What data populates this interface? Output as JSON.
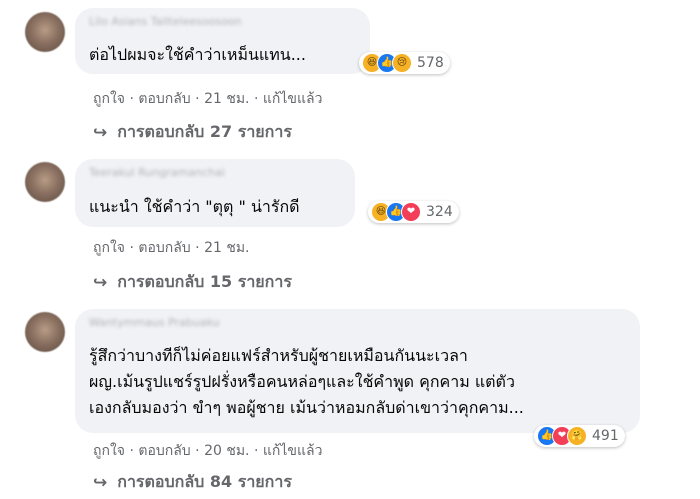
{
  "comments": [
    {
      "author": "Lilo Asians Tallteleesoosoon",
      "text": "ต่อไปผมจะใช้คำว่าเหม็นแทน...",
      "reactions": [
        "haha-icon",
        "like-icon",
        "sad-icon"
      ],
      "reaction_count": "578",
      "like": "ถูกใจ",
      "reply": "ตอบกลับ",
      "time": "21 ชม.",
      "edited": "แก้ไขแล้ว",
      "replies": "การตอบกลับ 27 รายการ"
    },
    {
      "author": "Teerakul Rungramanchai",
      "text": "แนะนำ ใช้คำว่า \"ตุตุ \" น่ารักดี",
      "reactions": [
        "haha-icon",
        "like-icon",
        "love-icon"
      ],
      "reaction_count": "324",
      "like": "ถูกใจ",
      "reply": "ตอบกลับ",
      "time": "21 ชม.",
      "edited": "",
      "replies": "การตอบกลับ 15 รายการ"
    },
    {
      "author": "Wantymmaus Prabuaku",
      "text": "รู้สึกว่าบางทีก็ไม่ค่อยแฟร์สำหรับผู้ชายเหมือนกันนะเวลา\nผญ.เม้นรูปแชร์รูปฝรั่งหรือคนหล่อๆและใช้คำพูด คุกคาม แต่ตัว\nเองกลับมองว่า ขำๆ พอผู้ชาย เม้นว่าหอมกลับด่าเขาว่าคุกคาม...",
      "reactions": [
        "like-icon",
        "love-icon",
        "care-icon"
      ],
      "reaction_count": "491",
      "like": "ถูกใจ",
      "reply": "ตอบกลับ",
      "time": "20 ชม.",
      "edited": "แก้ไขแล้ว",
      "replies": "การตอบกลับ 84 รายการ"
    }
  ],
  "separator": "·",
  "colors": {
    "bubble": "#f0f2f5",
    "meta": "#65676b",
    "like_blue": "#1877f2",
    "love_red": "#f33e58",
    "haha_yellow": "#f7b125"
  }
}
